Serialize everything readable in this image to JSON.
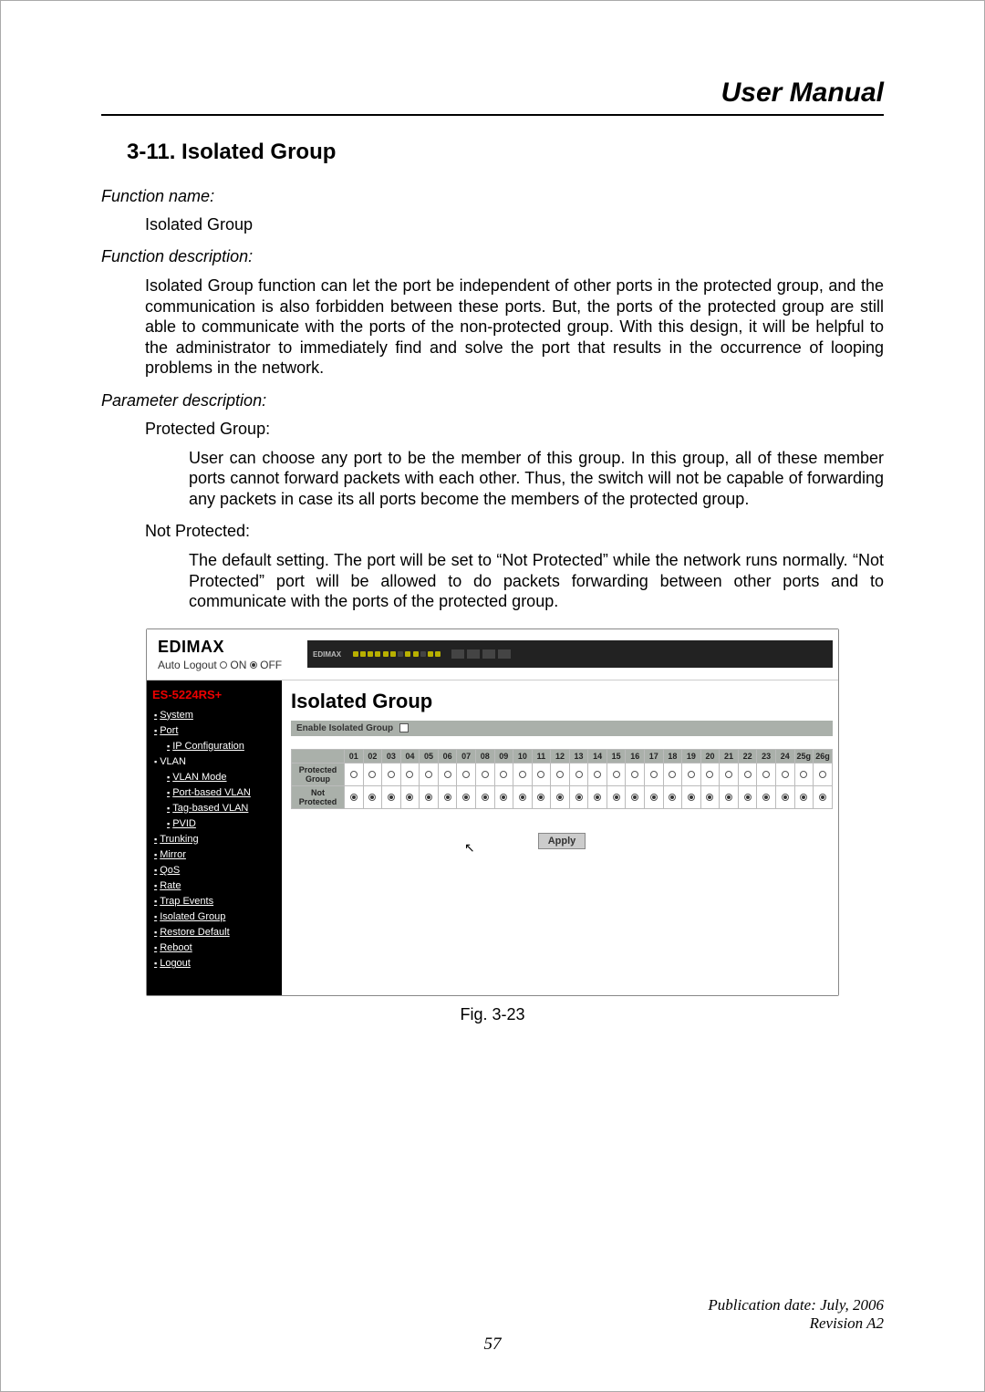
{
  "header": {
    "title": "User Manual"
  },
  "section": {
    "title": "3-11. Isolated Group",
    "fn_name_label": "Function name:",
    "fn_name": "Isolated Group",
    "fn_desc_label": "Function description:",
    "fn_desc": "Isolated Group function can let the port be independent of other ports in the protected group, and the communication is also forbidden between these ports. But, the ports of the protected group are still able to communicate with the ports of the non-protected group. With this design, it will be helpful to the administrator to immediately find and solve the port that results in the occurrence of looping problems in the network.",
    "param_label": "Parameter description:",
    "params": {
      "protected_h": "Protected Group:",
      "protected_p": "User can choose any port to be the member of this group. In this group, all of these member ports cannot forward packets with each other. Thus, the switch will not be capable of forwarding any packets in case its all ports become the members of the protected group.",
      "notprot_h": "Not Protected:",
      "notprot_p": "The default setting. The port will be set to “Not Protected” while the network runs normally. “Not Protected” port will be allowed to do packets forwarding between other ports and to communicate with the ports of the protected group."
    }
  },
  "screenshot": {
    "brand": "EDIMAX",
    "auto_logout_label": "Auto Logout",
    "auto_logout_on": "ON",
    "auto_logout_off": "OFF",
    "auto_logout_selected": "OFF",
    "model": "ES-5224RS+",
    "sidebar": [
      {
        "label": "System",
        "link": true,
        "sub": false
      },
      {
        "label": "Port",
        "link": true,
        "sub": false
      },
      {
        "label": "IP Configuration",
        "link": true,
        "sub": true
      },
      {
        "label": "VLAN",
        "link": false,
        "sub": false
      },
      {
        "label": "VLAN Mode",
        "link": true,
        "sub": true
      },
      {
        "label": "Port-based VLAN",
        "link": true,
        "sub": true
      },
      {
        "label": "Tag-based VLAN",
        "link": true,
        "sub": true
      },
      {
        "label": "PVID",
        "link": true,
        "sub": true
      },
      {
        "label": "Trunking",
        "link": true,
        "sub": false
      },
      {
        "label": "Mirror",
        "link": true,
        "sub": false
      },
      {
        "label": "QoS",
        "link": true,
        "sub": false
      },
      {
        "label": "Rate",
        "link": true,
        "sub": false
      },
      {
        "label": "Trap Events",
        "link": true,
        "sub": false
      },
      {
        "label": "Isolated Group",
        "link": true,
        "sub": false
      },
      {
        "label": "Restore Default",
        "link": true,
        "sub": false
      },
      {
        "label": "Reboot",
        "link": true,
        "sub": false
      },
      {
        "label": "Logout",
        "link": true,
        "sub": false
      }
    ],
    "main": {
      "title": "Isolated Group",
      "enable_label": "Enable Isolated Group",
      "columns": [
        "01",
        "02",
        "03",
        "04",
        "05",
        "06",
        "07",
        "08",
        "09",
        "10",
        "11",
        "12",
        "13",
        "14",
        "15",
        "16",
        "17",
        "18",
        "19",
        "20",
        "21",
        "22",
        "23",
        "24",
        "25g",
        "26g"
      ],
      "rows": [
        {
          "label": "Protected Group",
          "selected": "none"
        },
        {
          "label": "Not Protected",
          "selected": "all"
        }
      ],
      "apply": "Apply"
    }
  },
  "caption": "Fig. 3-23",
  "footer": {
    "publication": "Publication date: July, 2006",
    "revision": "Revision A2",
    "page": "57"
  }
}
